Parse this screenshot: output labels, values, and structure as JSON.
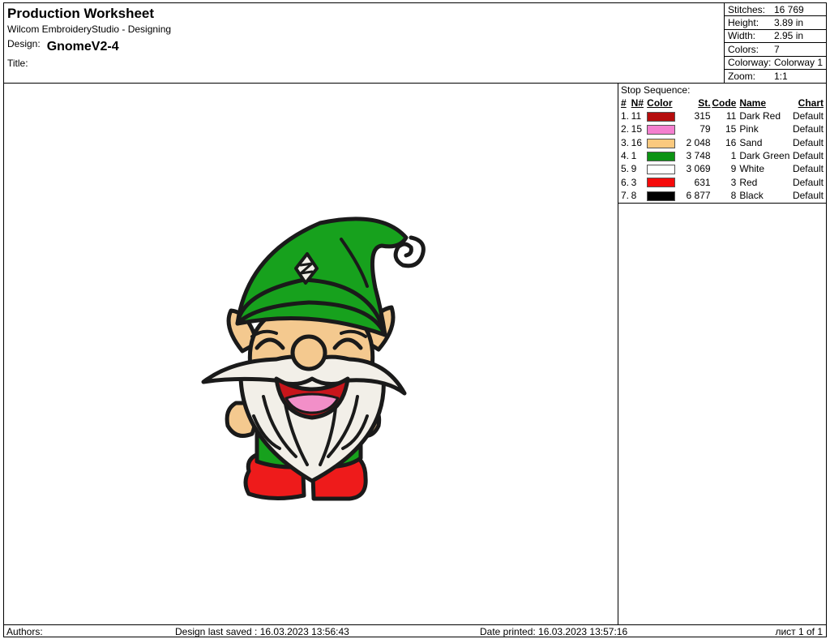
{
  "header": {
    "title": "Production Worksheet",
    "software": "Wilcom EmbroideryStudio - Designing",
    "design_label": "Design:",
    "design_name": "GnomeV2-4",
    "title_label": "Title:"
  },
  "stats": [
    {
      "label": "Stitches:",
      "value": "16 769"
    },
    {
      "label": "Height:",
      "value": "3.89 in"
    },
    {
      "label": "Width:",
      "value": "2.95 in"
    },
    {
      "label": "Colors:",
      "value": "7"
    },
    {
      "label": "Colorway:",
      "value": "Colorway 1"
    },
    {
      "label": "Zoom:",
      "value": "1:1"
    }
  ],
  "stop_sequence": {
    "title": "Stop Sequence:",
    "columns": [
      "#",
      "N#",
      "Color",
      "St.",
      "Code",
      "Name",
      "Chart"
    ],
    "rows": [
      {
        "num": "1.",
        "n": "11",
        "color": "#b50d0d",
        "st": "315",
        "code": "11",
        "name": "Dark Red",
        "chart": "Default"
      },
      {
        "num": "2.",
        "n": "15",
        "color": "#f47fcf",
        "st": "79",
        "code": "15",
        "name": "Pink",
        "chart": "Default"
      },
      {
        "num": "3.",
        "n": "16",
        "color": "#fbc97e",
        "st": "2 048",
        "code": "16",
        "name": "Sand",
        "chart": "Default"
      },
      {
        "num": "4.",
        "n": "1",
        "color": "#0c9313",
        "st": "3 748",
        "code": "1",
        "name": "Dark Green",
        "chart": "Default"
      },
      {
        "num": "5.",
        "n": "9",
        "color": "#ffffff",
        "st": "3 069",
        "code": "9",
        "name": "White",
        "chart": "Default"
      },
      {
        "num": "6.",
        "n": "3",
        "color": "#f50a0a",
        "st": "631",
        "code": "3",
        "name": "Red",
        "chart": "Default"
      },
      {
        "num": "7.",
        "n": "8",
        "color": "#000000",
        "st": "6 877",
        "code": "8",
        "name": "Black",
        "chart": "Default"
      }
    ]
  },
  "footer": {
    "authors": "Authors:",
    "saved": "Design last saved : 16.03.2023 13:56:43",
    "printed": "Date printed: 16.03.2023 13:57:16",
    "page": "лист 1 of 1"
  },
  "design_colors": {
    "hat": "#17a11d",
    "skin": "#f4c98f",
    "beard": "#f2efe8",
    "boots": "#ee1b1b",
    "mouth": "#c8151b",
    "tongue": "#f28fc8",
    "outline": "#1a1a1a"
  }
}
